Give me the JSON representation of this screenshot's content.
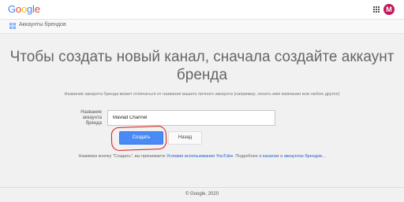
{
  "header": {
    "logo_letters": [
      {
        "ch": "G",
        "color": "#4285f4"
      },
      {
        "ch": "o",
        "color": "#ea4335"
      },
      {
        "ch": "o",
        "color": "#fbbc05"
      },
      {
        "ch": "g",
        "color": "#4285f4"
      },
      {
        "ch": "l",
        "color": "#34a853"
      },
      {
        "ch": "e",
        "color": "#ea4335"
      }
    ],
    "apps_icon": "apps-grid-icon",
    "avatar_letter": "M",
    "avatar_color": "#c2185b"
  },
  "subbar": {
    "icon": "brand-accounts-icon",
    "label": "Аккаунты брендов"
  },
  "main": {
    "heading_line1": "Чтобы создать новый канал, сначала создайте аккаунт",
    "heading_line2": "бренда",
    "description": "Название аккаунта бренда может отличаться от названия вашего личного аккаунта (например, носить имя компании или любое другое)",
    "field_label": "Название аккаунта бренда",
    "field_value": "Mavlad Channel",
    "create_label": "Создать",
    "back_label": "Назад",
    "accent_color": "#4a8af4",
    "highlight_color": "#d81818"
  },
  "terms": {
    "prefix": "Нажимая кнопку \"Создать\", вы принимаете ",
    "link_terms": "Условия использования YouTube",
    "middle": ". Подробнее ",
    "link_channels": "о каналах",
    "and": " и ",
    "link_brand": "аккаунтах брендов",
    "suffix": "..."
  },
  "footer": {
    "copyright": "© Google, 2020"
  }
}
